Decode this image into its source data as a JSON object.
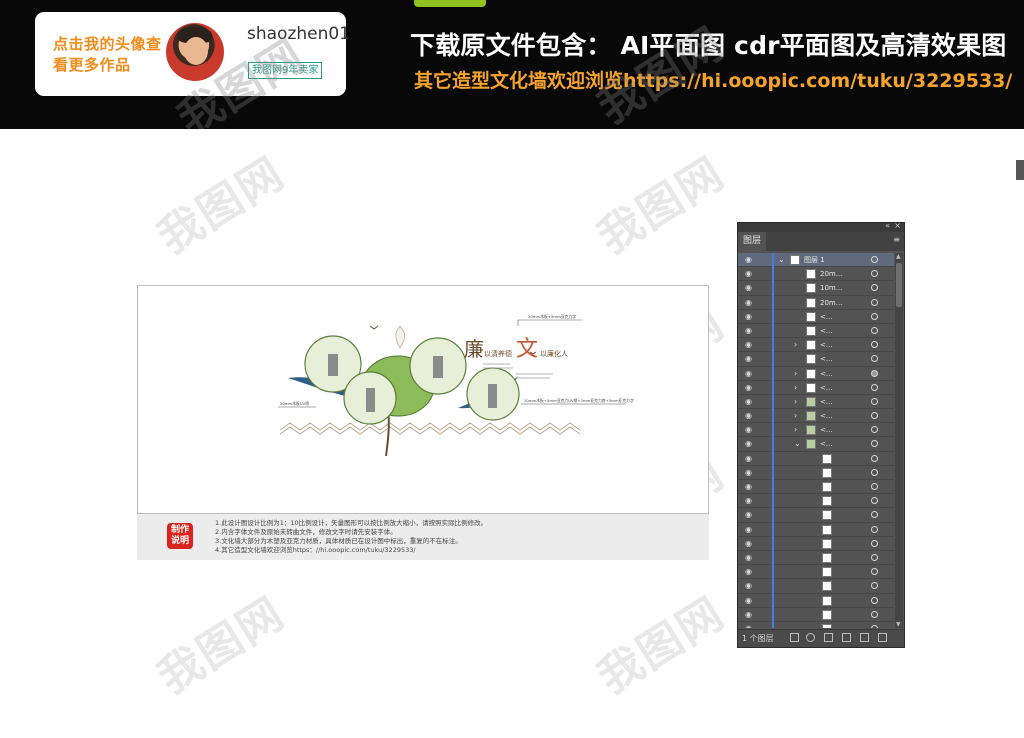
{
  "banner": {
    "author_prompt": "点击我的头像查看更多作品",
    "author_name": "shaozhen01",
    "seller_badge": "我图网9年卖家",
    "headline": "下载原文件包含：  AI平面图   cdr平面图及高清效果图",
    "subline": "其它造型文化墙欢迎浏览https://hi.ooopic.com/tuku/3229533/"
  },
  "watermark": "我图网",
  "artboard": {
    "title_chars": [
      "廉",
      "文"
    ],
    "subtitle_chars": [
      "以清养德",
      "以廉化人"
    ],
    "callouts": [
      "20mm木板+5mm亚克力字",
      "20mm木板UV喷",
      "20mm木板+5mm亚克力UV喷+3mm亚克力底+5mm亚克力字"
    ]
  },
  "notes": {
    "seal_text": "制作说明",
    "items": [
      "1.此设计图设计比例为1：10比例设计，矢量图形可以按比例放大缩小，请按照实际比例修改。",
      "2.内含字体文件及原始未转曲文件，修改文字时请先安装字体。",
      "3.文化墙大部分为木塑及亚克力材质，具体材质已在设计图中标出，重复的不在标注。",
      "4.其它造型文化墙欢迎浏览https：//hi.ooopic.com/tuku/3229533/"
    ]
  },
  "layers_panel": {
    "tab_label": "图层",
    "top_layer_name": "图层 1",
    "footer_count": "1 个图层",
    "rows": [
      {
        "name": "图层 1",
        "expanded": true,
        "level": 0
      },
      {
        "name": "20m...",
        "level": 1
      },
      {
        "name": "10m...",
        "level": 1
      },
      {
        "name": "20m...",
        "level": 1
      },
      {
        "name": "<...",
        "level": 1
      },
      {
        "name": "<...",
        "level": 1
      },
      {
        "name": "<...",
        "level": 1,
        "collapsed": true
      },
      {
        "name": "<...",
        "level": 1
      },
      {
        "name": "<...",
        "level": 1,
        "collapsed": true
      },
      {
        "name": "<...",
        "level": 1,
        "collapsed": true
      },
      {
        "name": "<...",
        "level": 1,
        "collapsed": true,
        "plant": true
      },
      {
        "name": "<...",
        "level": 1,
        "collapsed": true,
        "plant": true
      },
      {
        "name": "<...",
        "level": 1,
        "collapsed": true,
        "plant": true
      },
      {
        "name": "<...",
        "level": 1,
        "expanded": true,
        "plant": true
      },
      {
        "name": "",
        "level": 2
      },
      {
        "name": "",
        "level": 2
      },
      {
        "name": "",
        "level": 2
      },
      {
        "name": "",
        "level": 2
      },
      {
        "name": "",
        "level": 2
      },
      {
        "name": "",
        "level": 2
      },
      {
        "name": "",
        "level": 2
      },
      {
        "name": "",
        "level": 2
      },
      {
        "name": "",
        "level": 2
      },
      {
        "name": "",
        "level": 2
      },
      {
        "name": "",
        "level": 2
      },
      {
        "name": "",
        "level": 2
      },
      {
        "name": "",
        "level": 2
      }
    ]
  },
  "icons": {
    "eye": "eye-icon",
    "collapse": "double-chevron-icon",
    "close": "close-icon",
    "menu": "panel-menu-icon"
  },
  "colors": {
    "banner_bg": "#080808",
    "accent_orange": "#f5a32b",
    "panel_bg": "#535353",
    "layer_color_bar": "#4a78e6"
  }
}
